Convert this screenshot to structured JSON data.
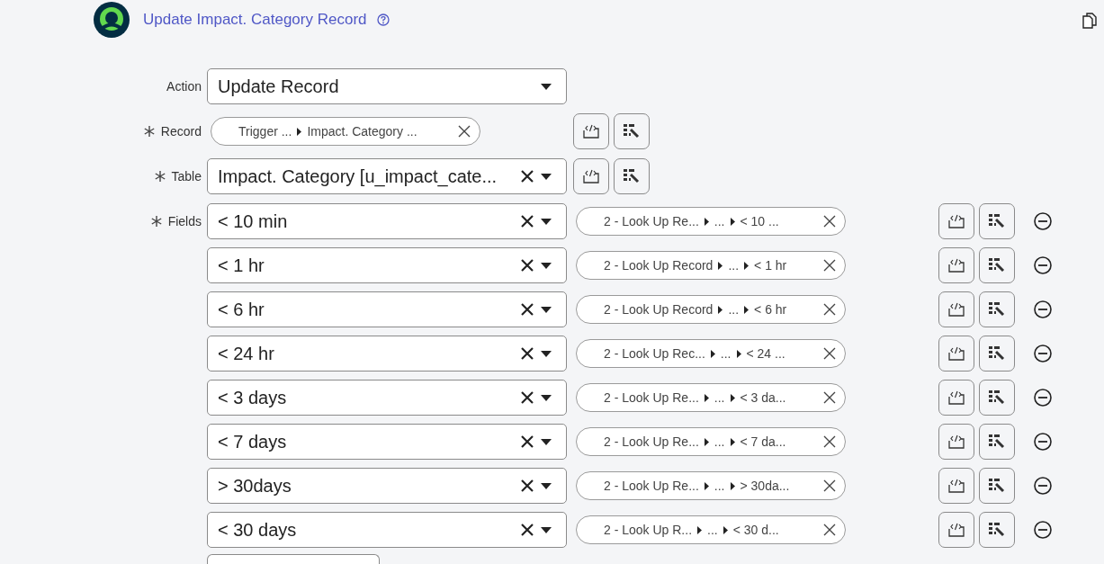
{
  "header": {
    "title": "Update Impact. Category Record"
  },
  "action": {
    "label": "Action",
    "value": "Update Record"
  },
  "record": {
    "label": "Record",
    "required": true,
    "pill": [
      "Trigger ...",
      "Impact. Category ..."
    ]
  },
  "table": {
    "label": "Table",
    "required": true,
    "value": "Impact. Category [u_impact_cate..."
  },
  "fields": {
    "label": "Fields",
    "required": true,
    "rows": [
      {
        "field": "< 10 min",
        "pill": [
          "2 - Look Up Re...",
          "...",
          "< 10 ..."
        ]
      },
      {
        "field": "< 1 hr",
        "pill": [
          "2 - Look Up Record",
          "...",
          "< 1 hr"
        ]
      },
      {
        "field": "< 6 hr",
        "pill": [
          "2 - Look Up Record",
          "...",
          "< 6 hr"
        ]
      },
      {
        "field": "< 24 hr",
        "pill": [
          "2 - Look Up Rec...",
          "...",
          "< 24 ..."
        ]
      },
      {
        "field": "< 3 days",
        "pill": [
          "2 - Look Up Re...",
          "...",
          "< 3 da..."
        ]
      },
      {
        "field": "< 7 days",
        "pill": [
          "2 - Look Up Re...",
          "...",
          "< 7 da..."
        ]
      },
      {
        "field": "> 30days",
        "pill": [
          "2 - Look Up Re...",
          "...",
          "> 30da..."
        ]
      },
      {
        "field": "< 30 days",
        "pill": [
          "2 - Look Up R...",
          "...",
          "< 30 d..."
        ]
      }
    ]
  }
}
